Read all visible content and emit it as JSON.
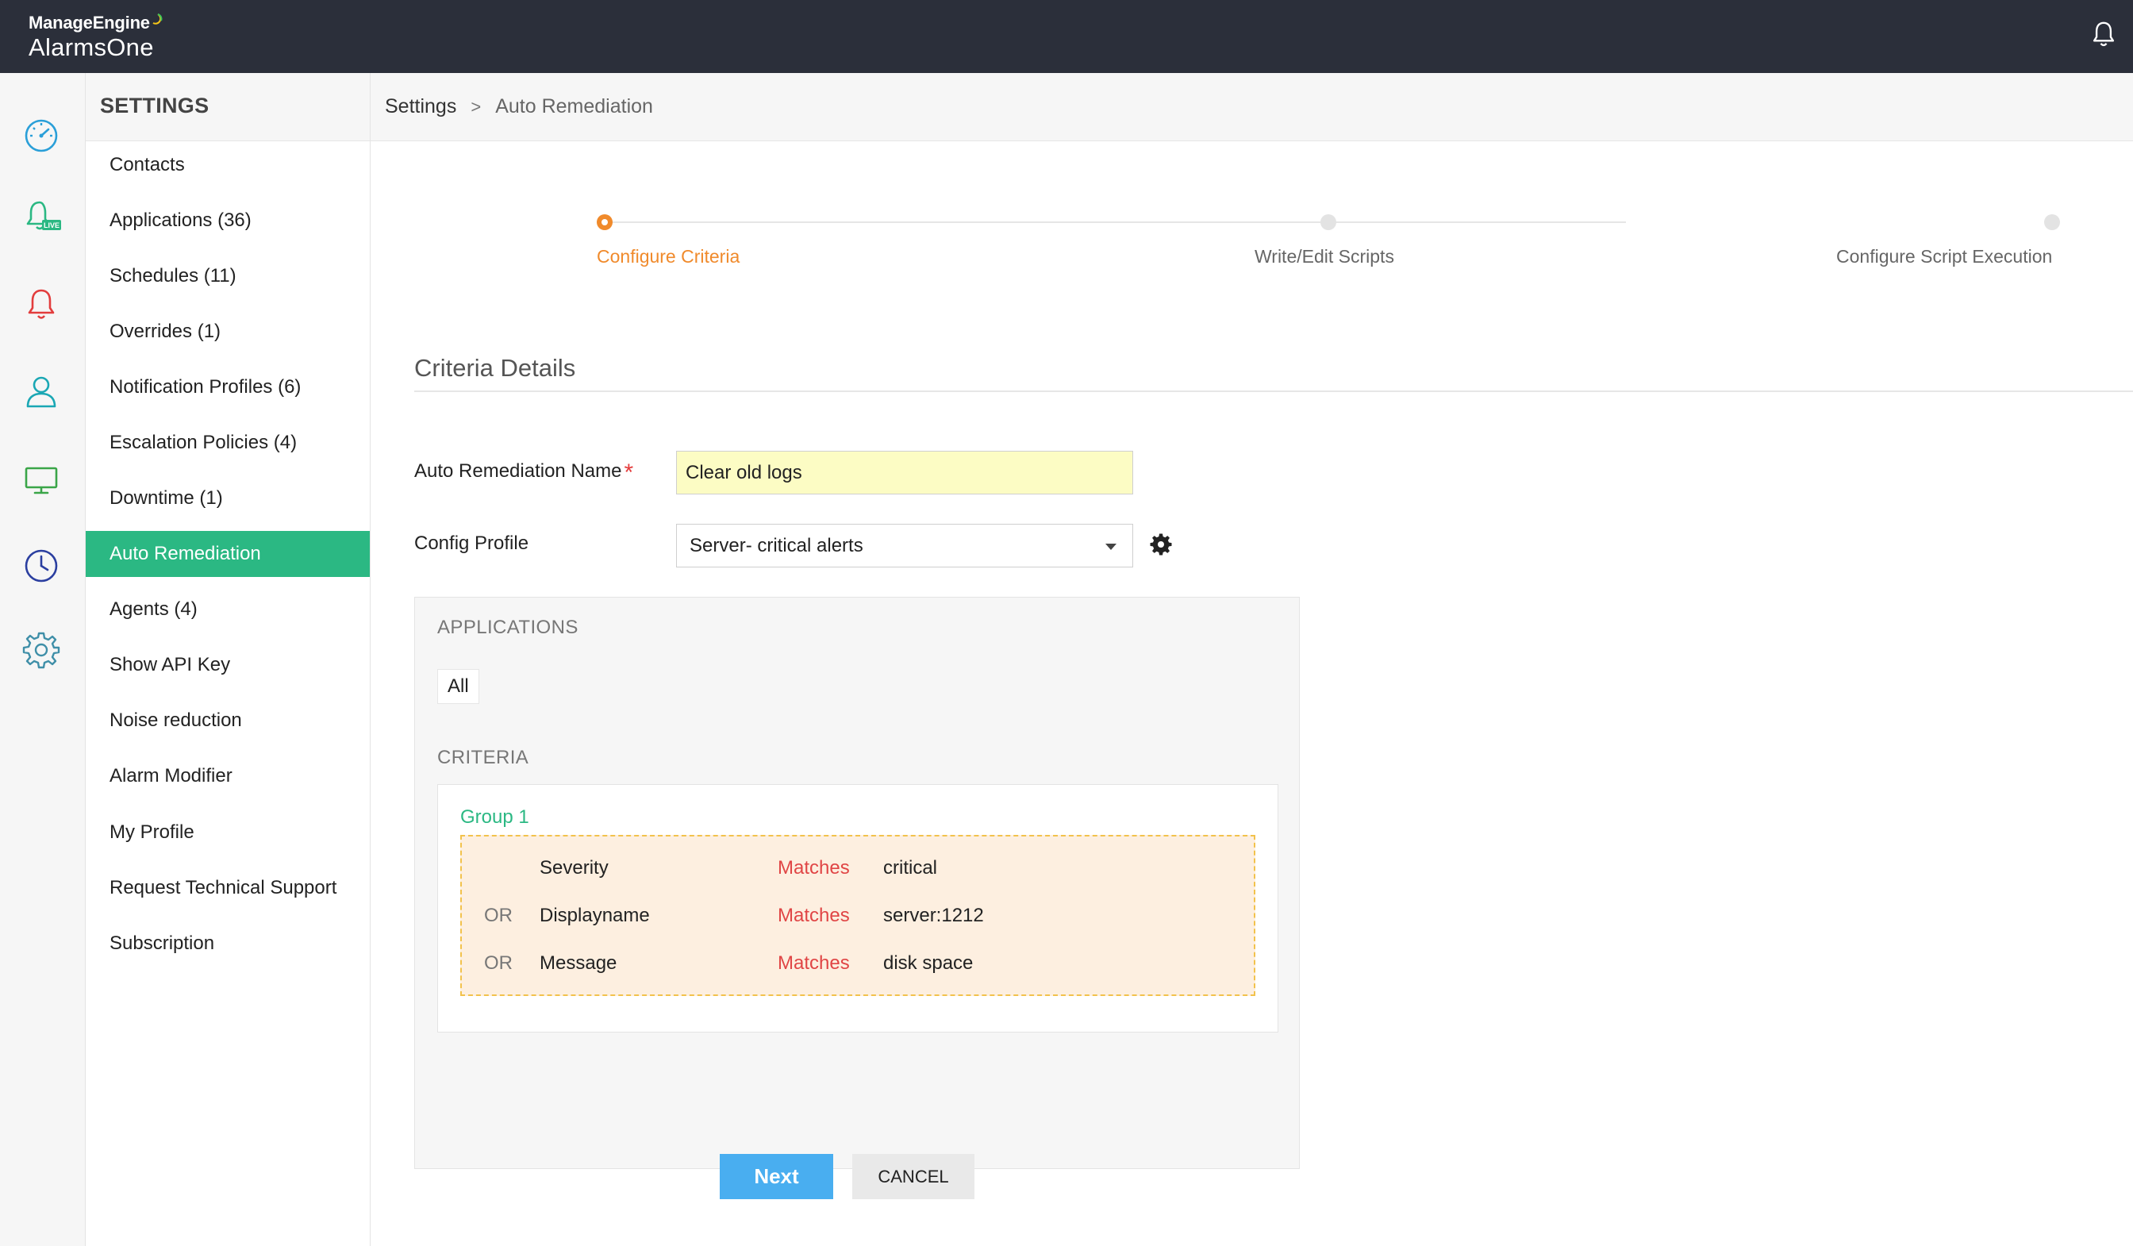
{
  "app": {
    "brand_top": "ManageEngine",
    "brand_bottom": "AlarmsOne"
  },
  "rail": {
    "icons": [
      "dashboard-gauge-icon",
      "live-alarms-bell-icon",
      "alarms-bell-icon",
      "user-icon",
      "monitor-icon",
      "clock-icon",
      "settings-gear-icon"
    ],
    "colors": {
      "dashboard": "#2a9fd8",
      "live": "#2bb883",
      "alarms": "#e23d3d",
      "user": "#1aa7b4",
      "monitor": "#3aa548",
      "clock": "#2b3fa0",
      "settings": "#3f8fa8"
    },
    "live_badge": "LIVE"
  },
  "sidebar": {
    "title": "SETTINGS",
    "items": [
      {
        "label": "Contacts"
      },
      {
        "label": "Applications (36)"
      },
      {
        "label": "Schedules (11)"
      },
      {
        "label": "Overrides (1)"
      },
      {
        "label": "Notification Profiles (6)"
      },
      {
        "label": "Escalation Policies (4)"
      },
      {
        "label": "Downtime (1)"
      },
      {
        "label": "Auto Remediation",
        "active": true
      },
      {
        "label": "Agents (4)"
      },
      {
        "label": "Show API Key"
      },
      {
        "label": "Noise reduction"
      },
      {
        "label": "Alarm Modifier"
      },
      {
        "label": "My Profile"
      },
      {
        "label": "Request Technical Support"
      },
      {
        "label": "Subscription"
      }
    ]
  },
  "breadcrumb": {
    "root": "Settings",
    "separator": ">",
    "current": "Auto Remediation"
  },
  "stepper": {
    "steps": [
      {
        "label": "Configure Criteria",
        "active": true
      },
      {
        "label": "Write/Edit Scripts",
        "active": false
      },
      {
        "label": "Configure Script Execution",
        "active": false
      }
    ]
  },
  "form": {
    "section_title": "Criteria Details",
    "name_label": "Auto Remediation Name",
    "required_marker": "*",
    "name_value": "Clear old logs",
    "profile_label": "Config Profile",
    "profile_value": "Server- critical alerts"
  },
  "panel": {
    "applications_heading": "APPLICATIONS",
    "applications_chip": "All",
    "criteria_heading": "CRITERIA",
    "group_label": "Group 1",
    "rows": [
      {
        "op": "",
        "field": "Severity",
        "match": "Matches",
        "value": "critical"
      },
      {
        "op": "OR",
        "field": "Displayname",
        "match": "Matches",
        "value": "server:1212"
      },
      {
        "op": "OR",
        "field": "Message",
        "match": "Matches",
        "value": "disk space"
      }
    ]
  },
  "buttons": {
    "next": "Next",
    "cancel": "CANCEL"
  },
  "colors": {
    "topbar": "#2b2f3a",
    "accent_green": "#2bb883",
    "accent_orange": "#f08a2b",
    "primary_blue": "#49aef0",
    "match_red": "#e04545"
  }
}
